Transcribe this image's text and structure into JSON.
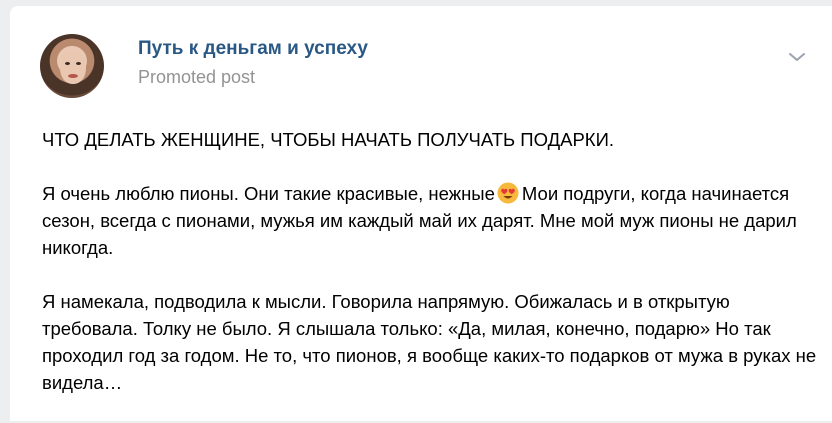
{
  "post": {
    "group_name": "Путь к деньгам и успеху",
    "post_type": "Promoted post",
    "avatar_icon": "woman-portrait-avatar",
    "menu_icon": "chevron-down-icon",
    "heading": "ЧТО ДЕЛАТЬ ЖЕНЩИНЕ, ЧТОБЫ НАЧАТЬ ПОЛУЧАТЬ ПОДАРКИ.",
    "paragraph1_before_emoji": "Я очень люблю пионы. Они такие красивые, нежные",
    "paragraph1_emoji": "heart-eyes-emoji",
    "paragraph1_after_emoji": "Мои подруги, когда начинается сезон, всегда с пионами, мужья им каждый май их дарят. Мне мой муж пионы не дарил никогда.",
    "paragraph2": "Я намекала, подводила к мысли. Говорила напрямую. Обижалась и в открытую требовала. Толку не было. Я слышала только: «Да, милая, конечно, подарю» Но так проходил год за годом. Не то, что пионов, я вообще каких-то подарков от мужа в руках не видела…"
  },
  "colors": {
    "group_name": "#2a5885",
    "secondary_text": "#939393",
    "background": "#edeef0",
    "card": "#ffffff"
  }
}
